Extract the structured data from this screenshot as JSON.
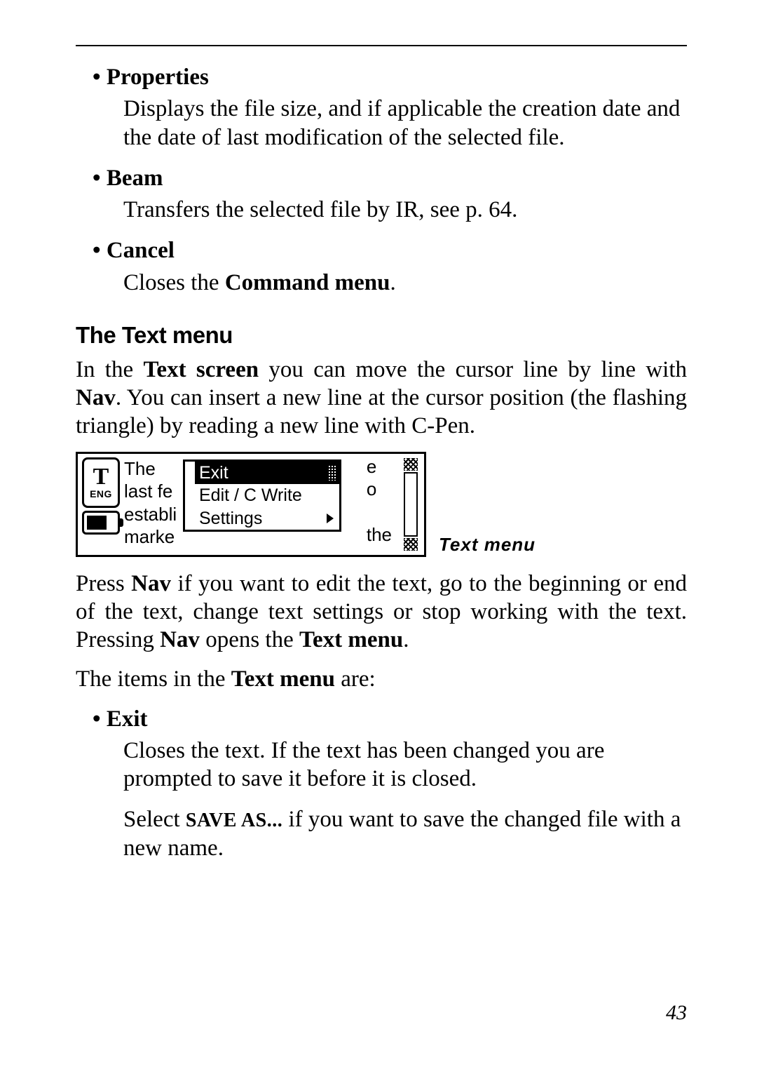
{
  "items_top": [
    {
      "title": "Properties",
      "desc": "Displays the file size, and if applicable the creation date and the date of last modification of the selected file."
    },
    {
      "title": "Beam",
      "desc": "Transfers the selected file by IR, see p. 64."
    },
    {
      "title": "Cancel",
      "desc_prefix": "Closes the ",
      "desc_bold": "Command menu",
      "desc_suffix": "."
    }
  ],
  "section_heading": "The Text menu",
  "para1": {
    "t1": "In the ",
    "b1": "Text screen",
    "t2": " you can move the cursor line by line with ",
    "b2": "Nav",
    "t3": ". You can insert a new line at the cursor position (the flashing triangle) by reading a new line with C-Pen."
  },
  "figure": {
    "t_label": "T",
    "eng": "ENG",
    "bg_lines": [
      "The",
      "last fe",
      "establi",
      "marke"
    ],
    "menu": [
      "Exit",
      "Edit / C Write",
      "Settings"
    ],
    "right_lines": [
      "e",
      "o",
      "",
      "the"
    ],
    "caption": "Text menu"
  },
  "para2": {
    "t1": "Press ",
    "b1": "Nav",
    "t2": " if you want to edit the text,  go to the beginning or end of the text, change text settings or stop working with the text. Pressing ",
    "b2": "Nav",
    "t3": " opens the ",
    "b3": "Text menu",
    "t4": "."
  },
  "para3": {
    "t1": "The items in the ",
    "b1": "Text menu",
    "t2": " are:"
  },
  "exit_item": {
    "title": "Exit",
    "desc1": "Closes the text. If the text has been changed you are prompted to save it before it is closed.",
    "desc2_prefix": "Select ",
    "desc2_smallcaps": "SAVE AS...",
    "desc2_suffix": " if you want to save the changed file with a new name."
  },
  "page_number": "43"
}
